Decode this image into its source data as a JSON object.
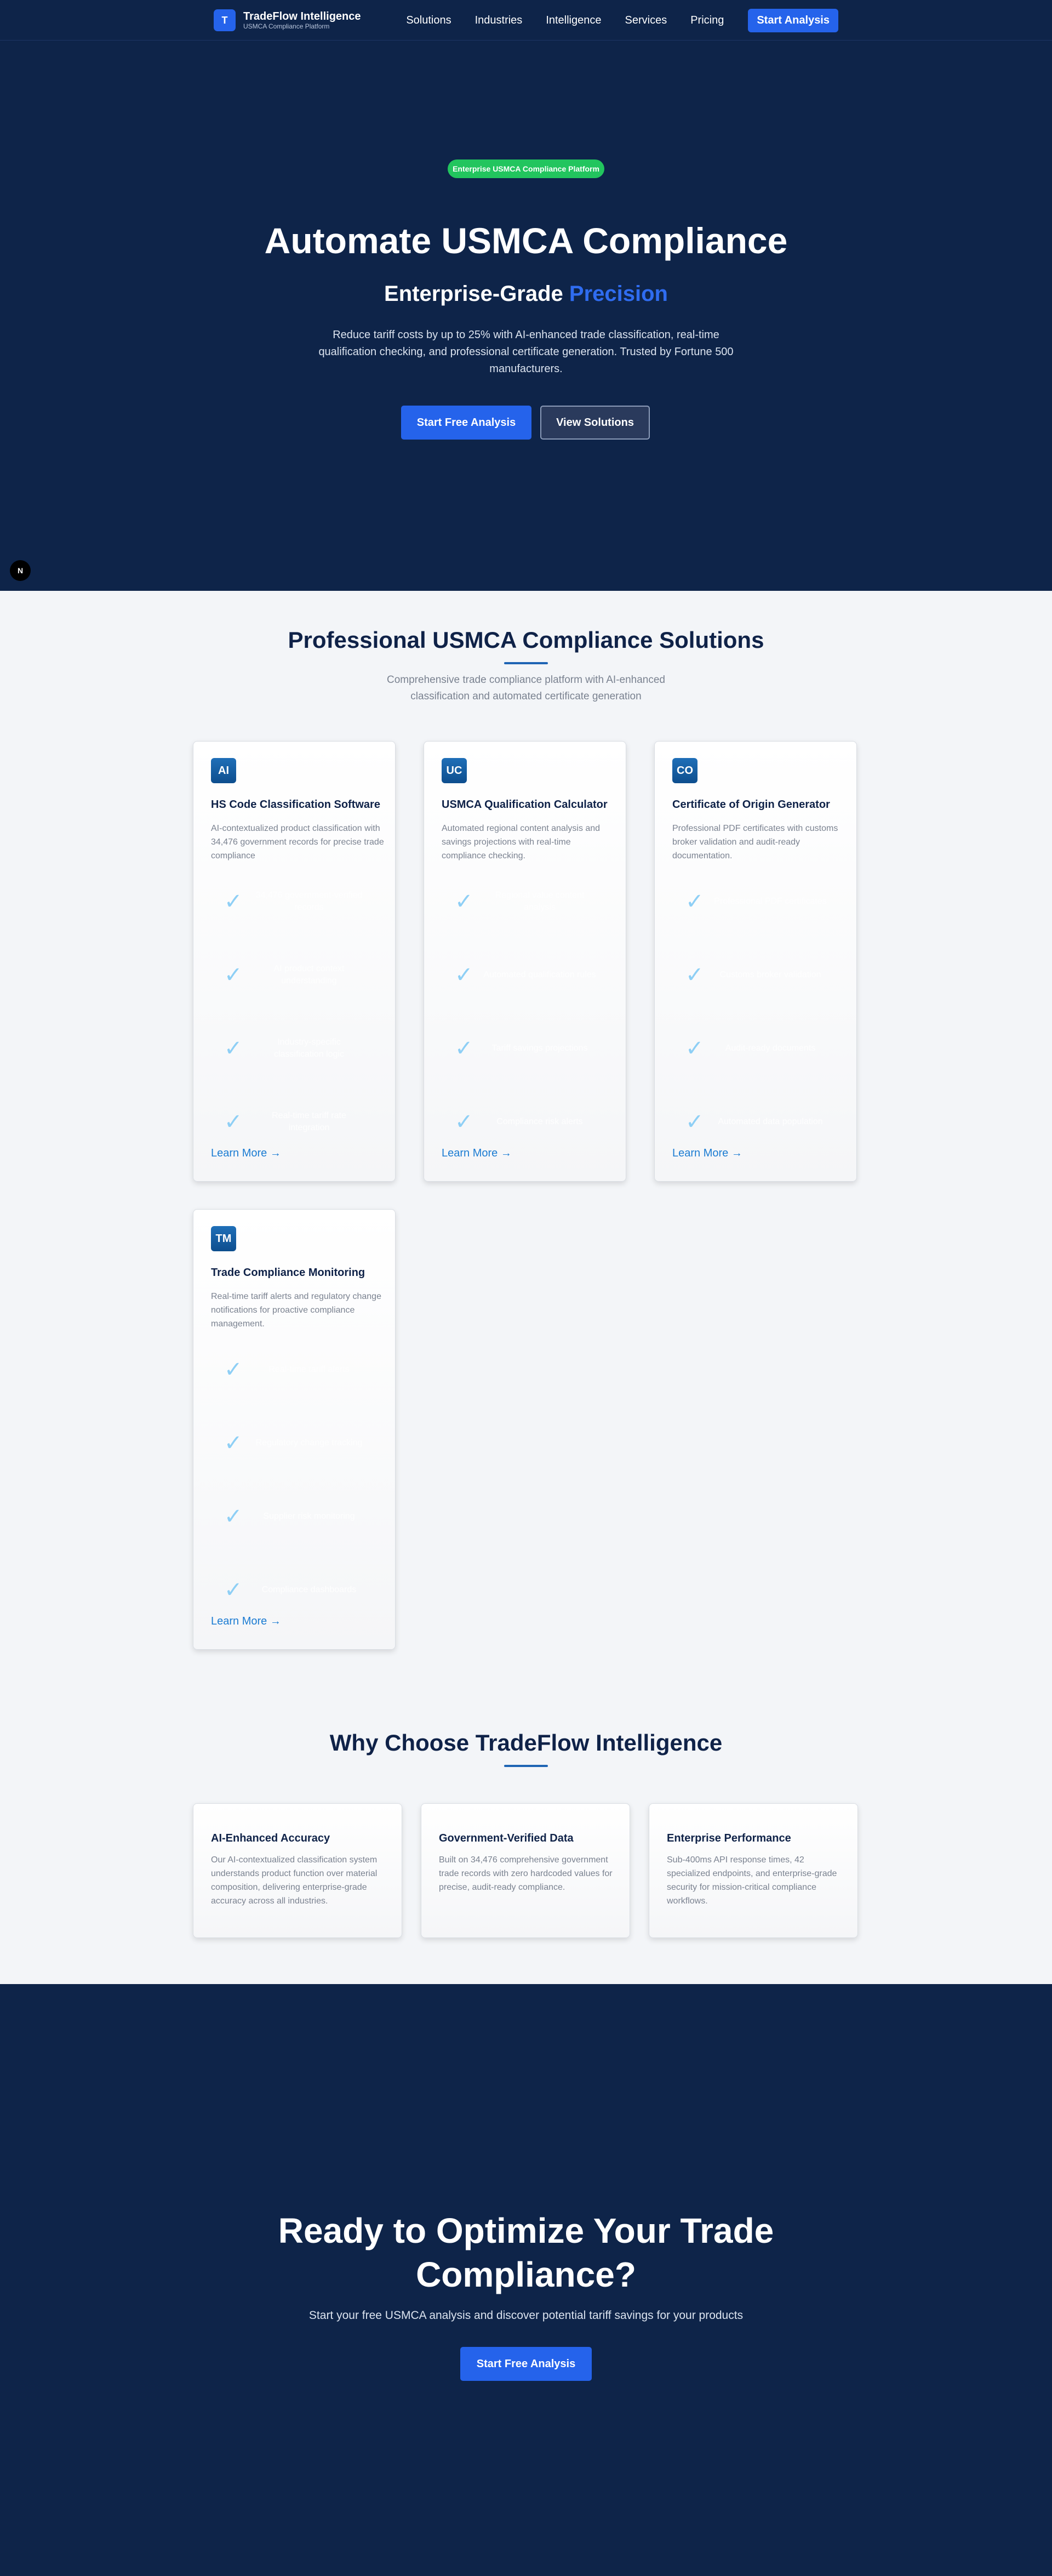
{
  "nav": {
    "logo_letter": "T",
    "brand_name": "TradeFlow Intelligence",
    "brand_sub": "USMCA Compliance Platform",
    "links": [
      "Solutions",
      "Industries",
      "Intelligence",
      "Services",
      "Pricing"
    ],
    "cta": "Start Analysis"
  },
  "hero": {
    "badge": "Enterprise USMCA Compliance Platform",
    "title": "Automate USMCA Compliance",
    "subtitle_plain": "Enterprise-Grade ",
    "subtitle_accent": "Precision",
    "description": "Reduce tariff costs by up to 25% with AI-enhanced trade classification, real-time qualification checking, and professional certificate generation. Trusted by Fortune 500 manufacturers.",
    "primary_button": "Start Free Analysis",
    "secondary_button": "View Solutions",
    "float_button": "N"
  },
  "solutions": {
    "title": "Professional USMCA Compliance Solutions",
    "description": "Comprehensive trade compliance platform with AI-enhanced classification and automated certificate generation",
    "learn_more": "Learn More →",
    "cards": [
      {
        "icon": "AI",
        "title": "HS Code Classification Software",
        "description": "AI-contextualized product classification with 34,476 government records for precise trade compliance",
        "features": [
          "34,476 government-verified records",
          "AI product context understanding",
          "Industry-specific classification logic",
          "Real-time tariff rate integration"
        ]
      },
      {
        "icon": "UC",
        "title": "USMCA Qualification Calculator",
        "description": "Automated regional content analysis and savings projections with real-time compliance checking.",
        "features": [
          "Regional value content analysis",
          "Automated qualification rules",
          "Tariff savings projections",
          "Compliance risk alerts"
        ]
      },
      {
        "icon": "CO",
        "title": "Certificate of Origin Generator",
        "description": "Professional PDF certificates with customs broker validation and audit-ready documentation.",
        "features": [
          "Professional PDF certificates",
          "Customs broker validation",
          "Audit-ready documents",
          "Automated data population"
        ]
      },
      {
        "icon": "TM",
        "title": "Trade Compliance Monitoring",
        "description": "Real-time tariff alerts and regulatory change notifications for proactive compliance management.",
        "features": [
          "Real-time tariff alerts",
          "Regulatory change tracking",
          "Supplier risk monitoring",
          "Compliance dashboards"
        ]
      }
    ]
  },
  "why": {
    "title": "Why Choose TradeFlow Intelligence",
    "cards": [
      {
        "title": "AI-Enhanced Accuracy",
        "description": "Our AI-contextualized classification system understands product function over material composition, delivering enterprise-grade accuracy across all industries."
      },
      {
        "title": "Government-Verified Data",
        "description": "Built on 34,476 comprehensive government trade records with zero hardcoded values for precise, audit-ready compliance."
      },
      {
        "title": "Enterprise Performance",
        "description": "Sub-400ms API response times, 42 specialized endpoints, and enterprise-grade security for mission-critical compliance workflows."
      }
    ]
  },
  "cta": {
    "title": "Ready to Optimize Your Trade Compliance?",
    "description": "Start your free USMCA analysis and discover potential tariff savings for your products",
    "button": "Start Free Analysis"
  },
  "colors": {
    "navy": "#0e2449",
    "primary_blue": "#2563eb",
    "badge_green": "#22c55e",
    "accent_blue": "#2f6cf0",
    "link_blue": "#1b7bd2"
  }
}
